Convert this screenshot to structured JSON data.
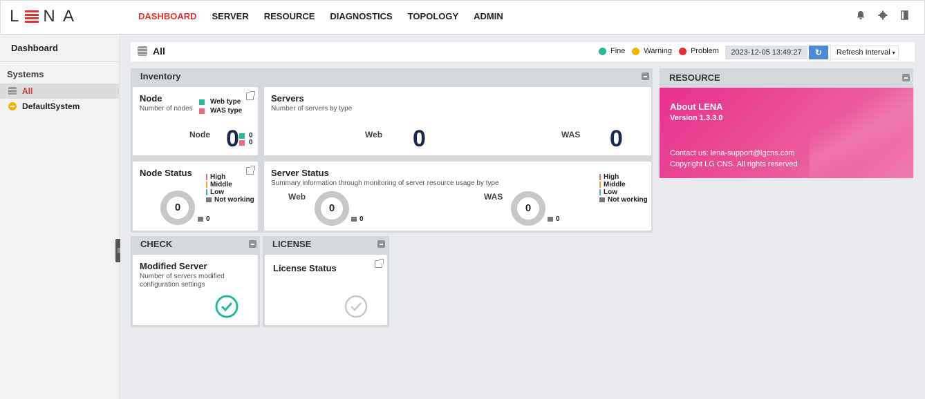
{
  "app": {
    "logo": "LENA"
  },
  "nav": {
    "items": [
      {
        "label": "DASHBOARD",
        "active": true
      },
      {
        "label": "SERVER"
      },
      {
        "label": "RESOURCE"
      },
      {
        "label": "DIAGNOSTICS"
      },
      {
        "label": "TOPOLOGY"
      },
      {
        "label": "ADMIN"
      }
    ]
  },
  "topicons": [
    "bell-icon",
    "gear-icon",
    "logout-icon"
  ],
  "sidebar": {
    "title": "Dashboard",
    "systems_label": "Systems",
    "items": [
      {
        "label": "All"
      },
      {
        "label": "DefaultSystem"
      }
    ]
  },
  "header": {
    "title": "All",
    "legend": {
      "fine": "Fine",
      "warning": "Warning",
      "problem": "Problem"
    },
    "timestamp": "2023-12-05 13:49:27",
    "refresh_interval": "Refresh Interval"
  },
  "colors": {
    "accent": "#e0322e",
    "fine": "#2fb79c",
    "warning": "#f5b400",
    "problem": "#e0322e",
    "web": "#26b79e",
    "was": "#ef6a7d",
    "high": "#ef6a7d",
    "middle": "#f5a623",
    "low": "#4aa8e8",
    "not_working": "#777777"
  },
  "inventory": {
    "title": "Inventory",
    "node": {
      "title": "Node",
      "subtitle": "Number of nodes",
      "legend_web": "Web type",
      "legend_was": "WAS type",
      "label": "Node",
      "total": "0",
      "web": "0",
      "was": "0"
    },
    "servers": {
      "title": "Servers",
      "subtitle": "Number of servers by type",
      "web_label": "Web",
      "web_value": "0",
      "was_label": "WAS",
      "was_value": "0"
    },
    "node_status": {
      "title": "Node Status",
      "value": "0",
      "not_working": "0"
    },
    "server_status": {
      "title": "Server Status",
      "subtitle": "Summary information through monitoring of server resource usage by type",
      "web_label": "Web",
      "web_value": "0",
      "web_not_working": "0",
      "was_label": "WAS",
      "was_value": "0",
      "was_not_working": "0"
    },
    "status_legend": {
      "high": "High",
      "middle": "Middle",
      "low": "Low",
      "not_working": "Not working"
    }
  },
  "resource": {
    "title": "RESOURCE",
    "about": "About LENA",
    "version": "Version 1.3.3.0",
    "contact": "Contact us: lena-support@lgcns.com",
    "copyright": "Copyright LG CNS. All rights reserved"
  },
  "check": {
    "title": "CHECK",
    "card_title": "Modified Server",
    "card_subtitle": "Number of servers modified configuration settings"
  },
  "license": {
    "title": "LICENSE",
    "card_title": "License Status"
  }
}
